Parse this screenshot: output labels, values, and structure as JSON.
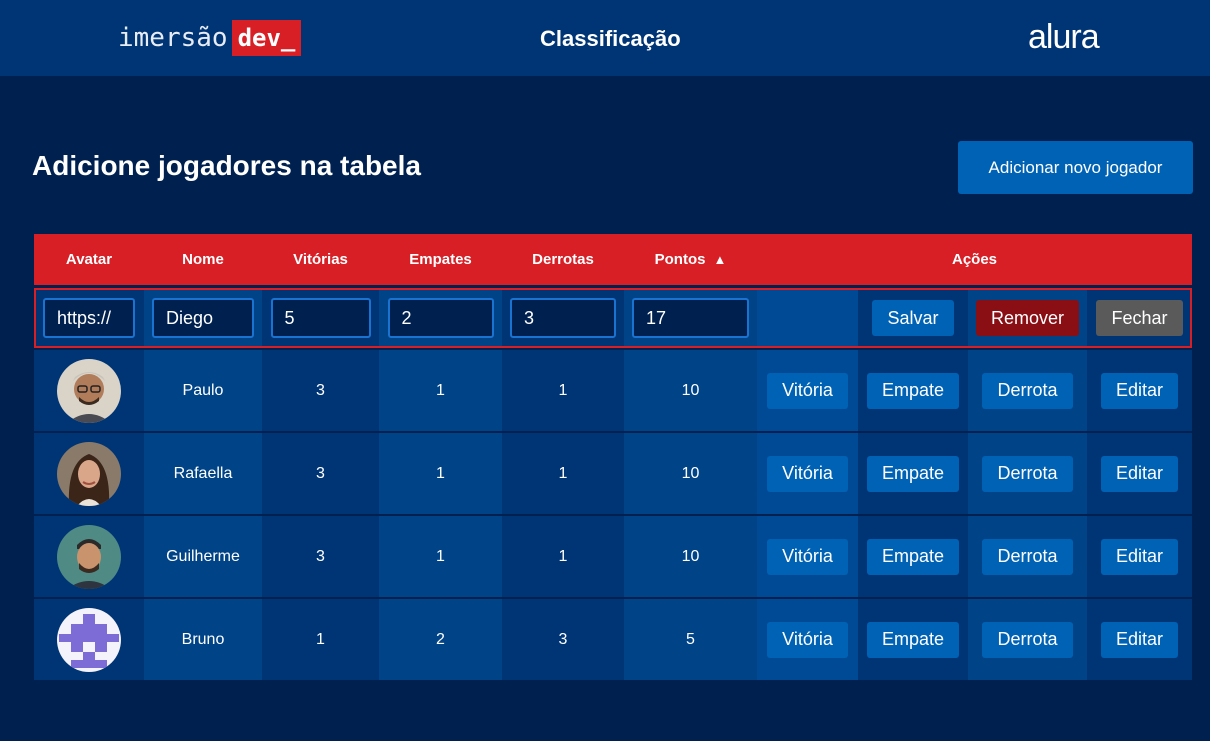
{
  "header": {
    "logo_word": "imersão",
    "logo_dev": "dev_",
    "title": "Classificação",
    "brand": "alura"
  },
  "section": {
    "title": "Adicione jogadores na tabela",
    "add_button": "Adicionar novo jogador"
  },
  "table": {
    "headers": {
      "avatar": "Avatar",
      "nome": "Nome",
      "vitorias": "Vitórias",
      "empates": "Empates",
      "derrotas": "Derrotas",
      "pontos": "Pontos",
      "sort_icon": "▲",
      "acoes": "Ações"
    },
    "edit_row": {
      "avatar": "https://",
      "nome": "Diego",
      "vitorias": "5",
      "empates": "2",
      "derrotas": "3",
      "pontos": "17",
      "save": "Salvar",
      "remove": "Remover",
      "close": "Fechar"
    },
    "actions": {
      "win": "Vitória",
      "draw": "Empate",
      "loss": "Derrota",
      "edit": "Editar"
    },
    "rows": [
      {
        "nome": "Paulo",
        "vitorias": "3",
        "empates": "1",
        "derrotas": "1",
        "pontos": "10"
      },
      {
        "nome": "Rafaella",
        "vitorias": "3",
        "empates": "1",
        "derrotas": "1",
        "pontos": "10"
      },
      {
        "nome": "Guilherme",
        "vitorias": "3",
        "empates": "1",
        "derrotas": "1",
        "pontos": "10"
      },
      {
        "nome": "Bruno",
        "vitorias": "1",
        "empates": "2",
        "derrotas": "3",
        "pontos": "5"
      }
    ]
  },
  "colors": {
    "background": "#00214f",
    "header_bar": "#003575",
    "accent_red": "#d81f26",
    "button_blue": "#0062b5"
  }
}
